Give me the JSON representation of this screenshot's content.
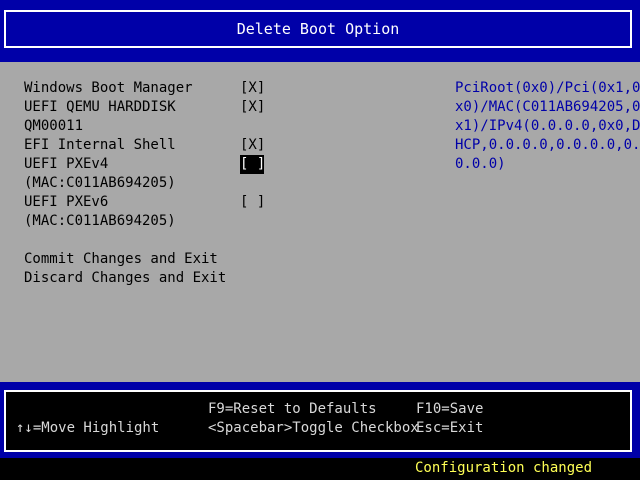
{
  "header": {
    "title": "Delete Boot Option"
  },
  "options": [
    {
      "label": "Windows Boot Manager",
      "checkbox": "[X]",
      "checked": true
    },
    {
      "label": "UEFI QEMU HARDDISK",
      "label_line2": "QM00011",
      "checkbox": "[X]",
      "checked": true
    },
    {
      "label": "EFI Internal Shell",
      "checkbox": "[X]",
      "checked": true
    },
    {
      "label": "UEFI PXEv4",
      "label_line2": "(MAC:C011AB694205)",
      "checkbox": "[ ]",
      "checked": false,
      "highlighted": true
    },
    {
      "label": "UEFI PXEv6",
      "label_line2": "(MAC:C011AB694205)",
      "checkbox": "[ ]",
      "checked": false
    }
  ],
  "actions": {
    "commit": "Commit Changes and Exit",
    "discard": "Discard Changes and Exit"
  },
  "help": {
    "lines": [
      "PciRoot(0x0)/Pci(0x1,0",
      "x0)/MAC(C011AB694205,0",
      "x1)/IPv4(0.0.0.0,0x0,D",
      "HCP,0.0.0.0,0.0.0.0,0.",
      "0.0.0)"
    ]
  },
  "footer": {
    "move": "↑↓=Move Highlight",
    "reset": "F9=Reset to Defaults",
    "toggle": "<Spacebar>Toggle Checkbox",
    "save": "F10=Save",
    "exit": "Esc=Exit"
  },
  "status": {
    "text": "Configuration changed"
  },
  "colors": {
    "background": "#0000a8",
    "panel": "#a8a8a8",
    "help_text": "#0000a8",
    "status_text": "#ffff55"
  }
}
